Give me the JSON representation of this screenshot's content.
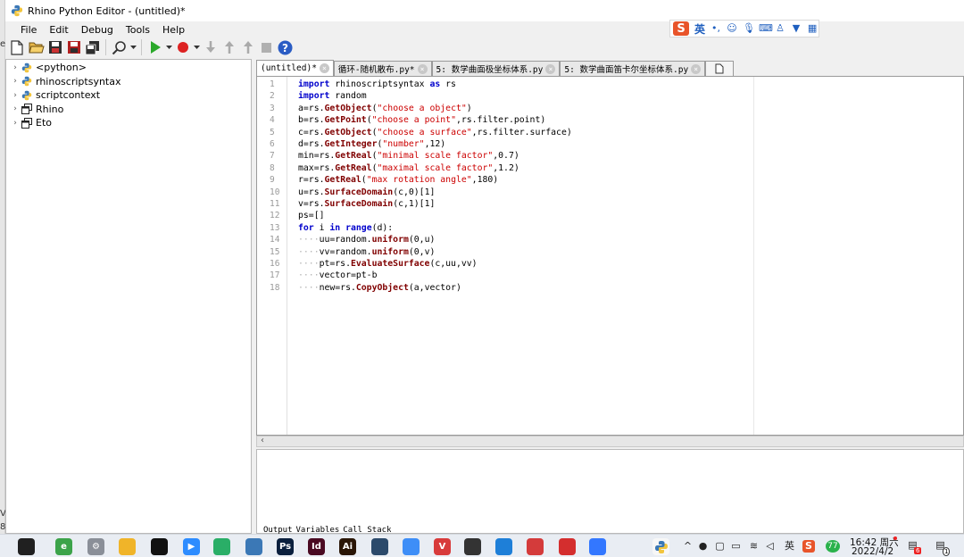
{
  "window": {
    "title": "Rhino Python Editor - (untitled)*"
  },
  "left_edge": {
    "a": "e",
    "b": "V",
    "c": "8"
  },
  "ime": {
    "label": "英",
    "icons": [
      "punctuation-icon",
      "smile-icon",
      "mic-icon",
      "keyboard-icon",
      "user-icon",
      "shirt-icon",
      "grid-icon"
    ]
  },
  "menu": {
    "items": [
      "File",
      "Edit",
      "Debug",
      "Tools",
      "Help"
    ]
  },
  "tree": {
    "items": [
      {
        "label": "<python>",
        "icon": "python-icon"
      },
      {
        "label": "rhinoscriptsyntax",
        "icon": "python-icon"
      },
      {
        "label": "scriptcontext",
        "icon": "python-icon"
      },
      {
        "label": "Rhino",
        "icon": "namespace-icon"
      },
      {
        "label": "Eto",
        "icon": "namespace-icon"
      }
    ]
  },
  "tabs": [
    {
      "label": "(untitled)*",
      "active": true
    },
    {
      "label": "循环-随机散布.py*",
      "active": false
    },
    {
      "label": "5: 数学曲面极坐标体系.py",
      "active": false
    },
    {
      "label": "5: 数学曲面笛卡尔坐标体系.py",
      "active": false
    }
  ],
  "editor": {
    "line_numbers": [
      "1",
      "2",
      "3",
      "4",
      "5",
      "6",
      "7",
      "8",
      "9",
      "10",
      "11",
      "12",
      "13",
      "14",
      "15",
      "16",
      "17",
      "18"
    ],
    "lines": [
      {
        "indent": "",
        "segs": [
          {
            "t": "import",
            "c": "kw"
          },
          {
            "t": " rhinoscriptsyntax ",
            "c": ""
          },
          {
            "t": "as",
            "c": "kw"
          },
          {
            "t": " rs",
            "c": ""
          }
        ]
      },
      {
        "indent": "",
        "segs": [
          {
            "t": "import",
            "c": "kw"
          },
          {
            "t": " random",
            "c": ""
          }
        ]
      },
      {
        "indent": "",
        "segs": [
          {
            "t": "a=rs.",
            "c": ""
          },
          {
            "t": "GetObject",
            "c": "fn"
          },
          {
            "t": "(",
            "c": ""
          },
          {
            "t": "\"choose a object\"",
            "c": "str"
          },
          {
            "t": ")",
            "c": ""
          }
        ]
      },
      {
        "indent": "",
        "segs": [
          {
            "t": "b=rs.",
            "c": ""
          },
          {
            "t": "GetPoint",
            "c": "fn"
          },
          {
            "t": "(",
            "c": ""
          },
          {
            "t": "\"choose a point\"",
            "c": "str"
          },
          {
            "t": ",rs.filter.point)",
            "c": ""
          }
        ]
      },
      {
        "indent": "",
        "segs": [
          {
            "t": "c=rs.",
            "c": ""
          },
          {
            "t": "GetObject",
            "c": "fn"
          },
          {
            "t": "(",
            "c": ""
          },
          {
            "t": "\"choose a surface\"",
            "c": "str"
          },
          {
            "t": ",rs.filter.surface)",
            "c": ""
          }
        ]
      },
      {
        "indent": "",
        "segs": [
          {
            "t": "d=rs.",
            "c": ""
          },
          {
            "t": "GetInteger",
            "c": "fn"
          },
          {
            "t": "(",
            "c": ""
          },
          {
            "t": "\"number\"",
            "c": "str"
          },
          {
            "t": ",12)",
            "c": ""
          }
        ]
      },
      {
        "indent": "",
        "segs": [
          {
            "t": "min=rs.",
            "c": ""
          },
          {
            "t": "GetReal",
            "c": "fn"
          },
          {
            "t": "(",
            "c": ""
          },
          {
            "t": "\"minimal scale factor\"",
            "c": "str"
          },
          {
            "t": ",0.7)",
            "c": ""
          }
        ]
      },
      {
        "indent": "",
        "segs": [
          {
            "t": "max=rs.",
            "c": ""
          },
          {
            "t": "GetReal",
            "c": "fn"
          },
          {
            "t": "(",
            "c": ""
          },
          {
            "t": "\"maximal scale factor\"",
            "c": "str"
          },
          {
            "t": ",1.2)",
            "c": ""
          }
        ]
      },
      {
        "indent": "",
        "segs": [
          {
            "t": "r=rs.",
            "c": ""
          },
          {
            "t": "GetReal",
            "c": "fn"
          },
          {
            "t": "(",
            "c": ""
          },
          {
            "t": "\"max rotation angle\"",
            "c": "str"
          },
          {
            "t": ",180)",
            "c": ""
          }
        ]
      },
      {
        "indent": "",
        "segs": [
          {
            "t": "u=rs.",
            "c": ""
          },
          {
            "t": "SurfaceDomain",
            "c": "fn"
          },
          {
            "t": "(c,0)[1]",
            "c": ""
          }
        ]
      },
      {
        "indent": "",
        "segs": [
          {
            "t": "v=rs.",
            "c": ""
          },
          {
            "t": "SurfaceDomain",
            "c": "fn"
          },
          {
            "t": "(c,1)[1]",
            "c": ""
          }
        ]
      },
      {
        "indent": "",
        "segs": [
          {
            "t": "ps=[]",
            "c": ""
          }
        ]
      },
      {
        "indent": "",
        "segs": [
          {
            "t": "for",
            "c": "kw"
          },
          {
            "t": " i ",
            "c": ""
          },
          {
            "t": "in",
            "c": "kw"
          },
          {
            "t": " ",
            "c": ""
          },
          {
            "t": "range",
            "c": "kw"
          },
          {
            "t": "(d):",
            "c": ""
          }
        ]
      },
      {
        "indent": "····",
        "segs": [
          {
            "t": "uu=random.",
            "c": ""
          },
          {
            "t": "uniform",
            "c": "fn"
          },
          {
            "t": "(0,u)",
            "c": ""
          }
        ]
      },
      {
        "indent": "····",
        "segs": [
          {
            "t": "vv=random.",
            "c": ""
          },
          {
            "t": "uniform",
            "c": "fn"
          },
          {
            "t": "(0,v)",
            "c": ""
          }
        ]
      },
      {
        "indent": "····",
        "segs": [
          {
            "t": "pt=rs.",
            "c": ""
          },
          {
            "t": "EvaluateSurface",
            "c": "fn"
          },
          {
            "t": "(c,uu,vv)",
            "c": ""
          }
        ]
      },
      {
        "indent": "····",
        "segs": [
          {
            "t": "vector=pt-b",
            "c": ""
          }
        ]
      },
      {
        "indent": "····",
        "segs": [
          {
            "t": "new=rs.",
            "c": ""
          },
          {
            "t": "CopyObject",
            "c": "fn"
          },
          {
            "t": "(a,vector)",
            "c": ""
          }
        ]
      }
    ]
  },
  "output_tabs": [
    "Output",
    "Variables",
    "Call Stack"
  ],
  "taskbar": {
    "apps": [
      {
        "name": "windows-start-icon",
        "color": "#202020",
        "label": ""
      },
      {
        "name": "browser-icon",
        "color": "#3ca34a",
        "label": "e"
      },
      {
        "name": "settings-app-icon",
        "color": "#8a8f98",
        "label": "⚙"
      },
      {
        "name": "file-explorer-icon",
        "color": "#f0b429",
        "label": ""
      },
      {
        "name": "qq-icon",
        "color": "#111111",
        "label": ""
      },
      {
        "name": "zoom-icon",
        "color": "#2d8cff",
        "label": "▶"
      },
      {
        "name": "wechat-icon",
        "color": "#2aae67",
        "label": ""
      },
      {
        "name": "python-app-icon",
        "color": "#3b78b6",
        "label": ""
      },
      {
        "name": "photoshop-icon",
        "color": "#0a1f3d",
        "label": "Ps"
      },
      {
        "name": "indesign-icon",
        "color": "#4a0a22",
        "label": "Id"
      },
      {
        "name": "illustrator-icon",
        "color": "#2a1606",
        "label": "Ai"
      },
      {
        "name": "cat-app-icon",
        "color": "#2c4a6b",
        "label": ""
      },
      {
        "name": "baidu-netdisk-icon",
        "color": "#3e8ef7",
        "label": ""
      },
      {
        "name": "v-app-icon",
        "color": "#d83b3b",
        "label": "V"
      },
      {
        "name": "rhino-icon",
        "color": "#333333",
        "label": ""
      },
      {
        "name": "mountain-app-icon",
        "color": "#1e7fd8",
        "label": ""
      },
      {
        "name": "sketchup-icon",
        "color": "#d43b3b",
        "label": ""
      },
      {
        "name": "acrobat-icon",
        "color": "#d42e2e",
        "label": ""
      },
      {
        "name": "feishu-icon",
        "color": "#3377ff",
        "label": ""
      },
      {
        "name": "python-icon",
        "color": "#f7f7f7",
        "label": ""
      }
    ],
    "tray": [
      "chevron-up-icon",
      "qq-tray-icon",
      "tray-2-icon",
      "battery-icon",
      "wifi-icon",
      "volume-icon",
      "ime-tray-icon",
      "sogou-tray-icon",
      "360-icon"
    ],
    "ime_label": "英",
    "clock_time": "16:42 周六",
    "clock_date": "2022/4/2",
    "badge1": "6",
    "badge2": "1"
  }
}
